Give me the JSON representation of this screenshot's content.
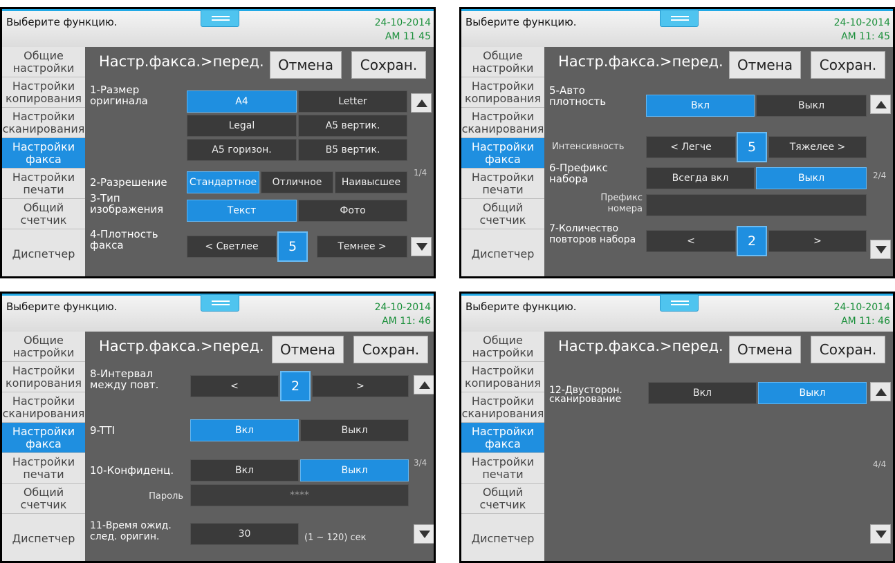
{
  "common": {
    "prompt": "Выберите функцию.",
    "date": "24-10-2014",
    "breadcrumb": "Настр.факса.>перед.",
    "cancel": "Отмена",
    "save": "Сохран.",
    "sidebar": [
      "Общие\nнастройки",
      "Настройки\nкопирования",
      "Настройки\nсканирования",
      "Настройки\nфакса",
      "Настройки\nпечати",
      "Общий\nсчетчик",
      "Диспетчер"
    ],
    "active_sidebar_index": 3,
    "icons": {
      "page_up": "triangle-up-icon",
      "page_down": "triangle-down-icon",
      "drag_handle": "menu-handle-icon"
    },
    "colors": {
      "accent": "#1f8fe0",
      "time": "#1a8f3a"
    }
  },
  "screens": [
    {
      "time": "AM 11  45",
      "page": "1/4",
      "rows": {
        "r1_label": "1-Размер\nоригинала",
        "a4": "A4",
        "letter": "Letter",
        "legal": "Legal",
        "a5v": "A5 вертик.",
        "a5h": "A5 горизон.",
        "b5v": "B5 вертик.",
        "r2_label": "2-Разрешение",
        "standard": "Стандартное",
        "fine": "Отличное",
        "superfine": "Наивысшее",
        "r3_label": "3-Тип\nизображения",
        "text": "Текст",
        "photo": "Фото",
        "r4_label": "4-Плотность\nфакса",
        "lighter": "< Светлее",
        "density": "5",
        "darker": "Темнее >"
      }
    },
    {
      "time": "AM 11: 45",
      "page": "2/4",
      "rows": {
        "r5_label": "5-Авто\nплотность",
        "on": "Вкл",
        "off": "Выкл",
        "intensity_label": "Интенсивность",
        "lighter": "< Легче",
        "intensity": "5",
        "heavier": "Тяжелее >",
        "r6_label": "6-Префикс\nнабора",
        "always_on": "Всегда вкл",
        "off2": "Выкл",
        "prefix_label": "Префикс\nномера",
        "prefix_value": "",
        "r7_label": "7-Количество\nповторов набора",
        "prev": "<",
        "retries": "2",
        "next": ">"
      }
    },
    {
      "time": "AM 11: 46",
      "page": "3/4",
      "rows": {
        "r8_label": "8-Интервал\nмежду повт.",
        "prev": "<",
        "interval": "2",
        "next": ">",
        "r9_label": "9-TTI",
        "on": "Вкл",
        "off": "Выкл",
        "r10_label": "10-Конфиденц.",
        "on2": "Вкл",
        "off2": "Выкл",
        "password_label": "Пароль",
        "password_value": "****",
        "r11_label": "11-Время ожид.\nслед. оригин.",
        "wait_value": "30",
        "wait_range": "(1 ~ 120) сек"
      }
    },
    {
      "time": "AM 11: 46",
      "page": "4/4",
      "rows": {
        "r12_label": "12-Двусторон.\nсканирование",
        "on": "Вкл",
        "off": "Выкл"
      }
    }
  ]
}
